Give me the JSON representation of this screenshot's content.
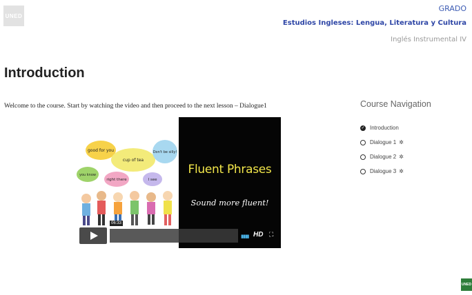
{
  "logo": {
    "text": "UNED"
  },
  "header": {
    "grado": "GRADO",
    "degree": "Estudios Ingleses: Lengua, Literatura y Cultura",
    "course": "Inglés Instrumental IV"
  },
  "page": {
    "title": "Introduction",
    "welcome": "Welcome to the course. Start by watching the video and then proceed to the next lesson – Dialogue1"
  },
  "course_navigation": {
    "title": "Course Navigation",
    "items": [
      {
        "label": "Introduction",
        "status": "completed",
        "icon": "check-circle-icon"
      },
      {
        "label": "Dialogue 1",
        "status": "open",
        "icon": "circle-icon"
      },
      {
        "label": "Dialogue 2",
        "status": "open",
        "icon": "circle-icon"
      },
      {
        "label": "Dialogue 3",
        "status": "open",
        "icon": "circle-icon"
      }
    ]
  },
  "video": {
    "title": "Fluent Phrases",
    "subtitle": "Sound more fluent!",
    "time": "06:33",
    "hd_label": "HD",
    "bubbles": [
      "good for you",
      "cup of tea",
      "Don't be silly!",
      "you know",
      "right there",
      "I see"
    ],
    "colors": {
      "title": "#f2e64a",
      "volume": "#4ab3e8"
    }
  },
  "footer_logo": {
    "text": "UNED"
  }
}
